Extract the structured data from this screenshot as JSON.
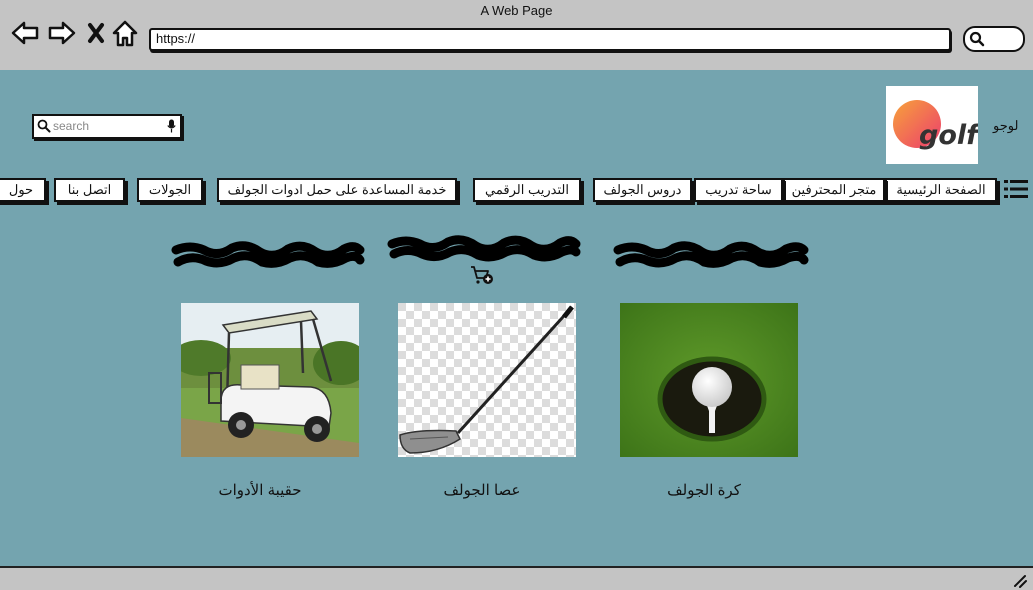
{
  "window": {
    "title": "A Web Page"
  },
  "browser": {
    "url": "https://"
  },
  "search": {
    "placeholder": "search"
  },
  "header": {
    "logo_label": "لوجو",
    "logo_text": "golf"
  },
  "nav": {
    "items": [
      {
        "label": "الصفحة الرئيسية"
      },
      {
        "label": "متجر المحترفين"
      },
      {
        "label": "ساحة تدريب"
      },
      {
        "label": "دروس الجولف"
      },
      {
        "label": "التدريب الرقمي"
      },
      {
        "label": "خدمة المساعدة على حمل ادوات الجولف"
      },
      {
        "label": "الجولات"
      },
      {
        "label": "اتصل بنا"
      },
      {
        "label": "حول"
      }
    ]
  },
  "products": [
    {
      "label": "كرة الجولف",
      "icon": "golf-ball-in-hole-image"
    },
    {
      "label": "عصا الجولف",
      "icon": "golf-club-image"
    },
    {
      "label": "حقيبة الأدوات",
      "icon": "golf-cart-image"
    }
  ],
  "colors": {
    "page_bg": "#74a4af",
    "chrome_bg": "#c4c4c4"
  }
}
